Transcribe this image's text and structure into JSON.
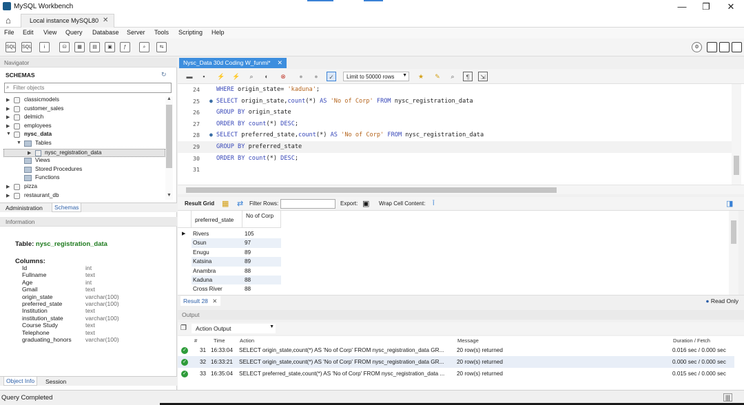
{
  "window": {
    "title": "MySQL Workbench",
    "minimize": "—",
    "maximize": "❐",
    "close": "✕"
  },
  "connection_tab": {
    "label": "Local instance MySQL80",
    "close": "✕"
  },
  "menu": [
    "File",
    "Edit",
    "View",
    "Query",
    "Database",
    "Server",
    "Tools",
    "Scripting",
    "Help"
  ],
  "navigator": {
    "header": "Navigator",
    "schemas_title": "SCHEMAS",
    "filter_placeholder": "Filter objects",
    "tree": [
      {
        "label": "classicmodels",
        "arrow": "▶",
        "kind": "db"
      },
      {
        "label": "customer_sales",
        "arrow": "▶",
        "kind": "db"
      },
      {
        "label": "delmich",
        "arrow": "▶",
        "kind": "db"
      },
      {
        "label": "employees",
        "arrow": "▶",
        "kind": "db"
      },
      {
        "label": "nysc_data",
        "arrow": "▼",
        "kind": "db"
      },
      {
        "label": "Tables",
        "arrow": "▼",
        "kind": "folder"
      },
      {
        "label": "nysc_registration_data",
        "arrow": "▶",
        "kind": "table"
      },
      {
        "label": "Views",
        "arrow": "",
        "kind": "folder"
      },
      {
        "label": "Stored Procedures",
        "arrow": "",
        "kind": "folder"
      },
      {
        "label": "Functions",
        "arrow": "",
        "kind": "folder"
      },
      {
        "label": "pizza",
        "arrow": "▶",
        "kind": "db"
      },
      {
        "label": "restaurant_db",
        "arrow": "▶",
        "kind": "db"
      }
    ],
    "tabs": {
      "admin": "Administration",
      "schemas": "Schemas"
    }
  },
  "information": {
    "header": "Information",
    "table_prefix": "Table:",
    "table_name": "nysc_registration_data",
    "columns_title": "Columns:",
    "columns": [
      {
        "name": "Id",
        "type": "int"
      },
      {
        "name": "Fullname",
        "type": "text"
      },
      {
        "name": "Age",
        "type": "int"
      },
      {
        "name": "Gmail",
        "type": "text"
      },
      {
        "name": "origin_state",
        "type": "varchar(100)"
      },
      {
        "name": "preferred_state",
        "type": "varchar(100)"
      },
      {
        "name": "Institution",
        "type": "text"
      },
      {
        "name": "institution_state",
        "type": "varchar(100)"
      },
      {
        "name": "Course Study",
        "type": "text"
      },
      {
        "name": "Telephone",
        "type": "text"
      },
      {
        "name": "graduating_honors",
        "type": "varchar(100)"
      }
    ],
    "tabs": {
      "object_info": "Object Info",
      "session": "Session"
    }
  },
  "editor": {
    "tab_label": "Nysc_Data 30d Coding W_funmi*",
    "tab_close": "✕",
    "limit_label": "Limit to 50000 rows",
    "lines": [
      {
        "n": "24",
        "dot": false
      },
      {
        "n": "25",
        "dot": true
      },
      {
        "n": "26",
        "dot": false
      },
      {
        "n": "27",
        "dot": false
      },
      {
        "n": "28",
        "dot": true
      },
      {
        "n": "29",
        "dot": false
      },
      {
        "n": "30",
        "dot": false
      },
      {
        "n": "31",
        "dot": false
      }
    ],
    "code": {
      "l24a": "WHERE",
      "l24b": " origin_state= ",
      "l24c": "'kaduna'",
      "l24d": ";",
      "l25a": "SELECT",
      "l25b": " origin_state,",
      "l25c": "count",
      "l25d": "(*) ",
      "l25e": "AS",
      "l25f": " ",
      "l25g": "'No of Corp'",
      "l25h": " ",
      "l25i": "FROM",
      "l25j": " nysc_registration_data",
      "l26a": "GROUP BY",
      "l26b": " origin_state",
      "l27a": "ORDER BY",
      "l27b": " ",
      "l27c": "count",
      "l27d": "(*) ",
      "l27e": "DESC",
      "l27f": ";",
      "l28a": "SELECT",
      "l28b": " preferred_state,",
      "l28c": "count",
      "l28d": "(*) ",
      "l28e": "AS",
      "l28f": " ",
      "l28g": "'No of Corp'",
      "l28h": " ",
      "l28i": "FROM",
      "l28j": " nysc_registration_data",
      "l29a": "GROUP BY",
      "l29b": " preferred_state",
      "l30a": "ORDER BY",
      "l30b": " ",
      "l30c": "count",
      "l30d": "(*) ",
      "l30e": "DESC",
      "l30f": ";"
    }
  },
  "result_toolbar": {
    "result_grid": "Result Grid",
    "filter_rows": "Filter Rows:",
    "export": "Export:",
    "wrap": "Wrap Cell Content:"
  },
  "result_grid": {
    "columns": [
      "preferred_state",
      "No of Corp"
    ],
    "rows": [
      [
        "Rivers",
        "105"
      ],
      [
        "Osun",
        "97"
      ],
      [
        "Enugu",
        "89"
      ],
      [
        "Katsina",
        "89"
      ],
      [
        "Anambra",
        "88"
      ],
      [
        "Kaduna",
        "88"
      ],
      [
        "Cross River",
        "88"
      ]
    ]
  },
  "result_tab": {
    "label": "Result 28",
    "close": "✕",
    "read_only": "Read Only"
  },
  "output": {
    "header": "Output",
    "selector": "Action Output",
    "columns": [
      "#",
      "Time",
      "Action",
      "Message",
      "Duration / Fetch"
    ],
    "rows": [
      {
        "n": "31",
        "time": "16:33:04",
        "action": "SELECT origin_state,count(*) AS 'No of Corp' FROM nysc_registration_data GR...",
        "message": "20 row(s) returned",
        "duration": "0.016 sec / 0.000 sec"
      },
      {
        "n": "32",
        "time": "16:33:21",
        "action": "SELECT origin_state,count(*) AS 'No of Corp' FROM nysc_registration_data GR...",
        "message": "20 row(s) returned",
        "duration": "0.000 sec / 0.000 sec"
      },
      {
        "n": "33",
        "time": "16:35:04",
        "action": "SELECT preferred_state,count(*) AS 'No of Corp' FROM nysc_registration_data ...",
        "message": "20 row(s) returned",
        "duration": "0.015 sec / 0.000 sec"
      }
    ]
  },
  "status": {
    "text": "Query Completed"
  }
}
